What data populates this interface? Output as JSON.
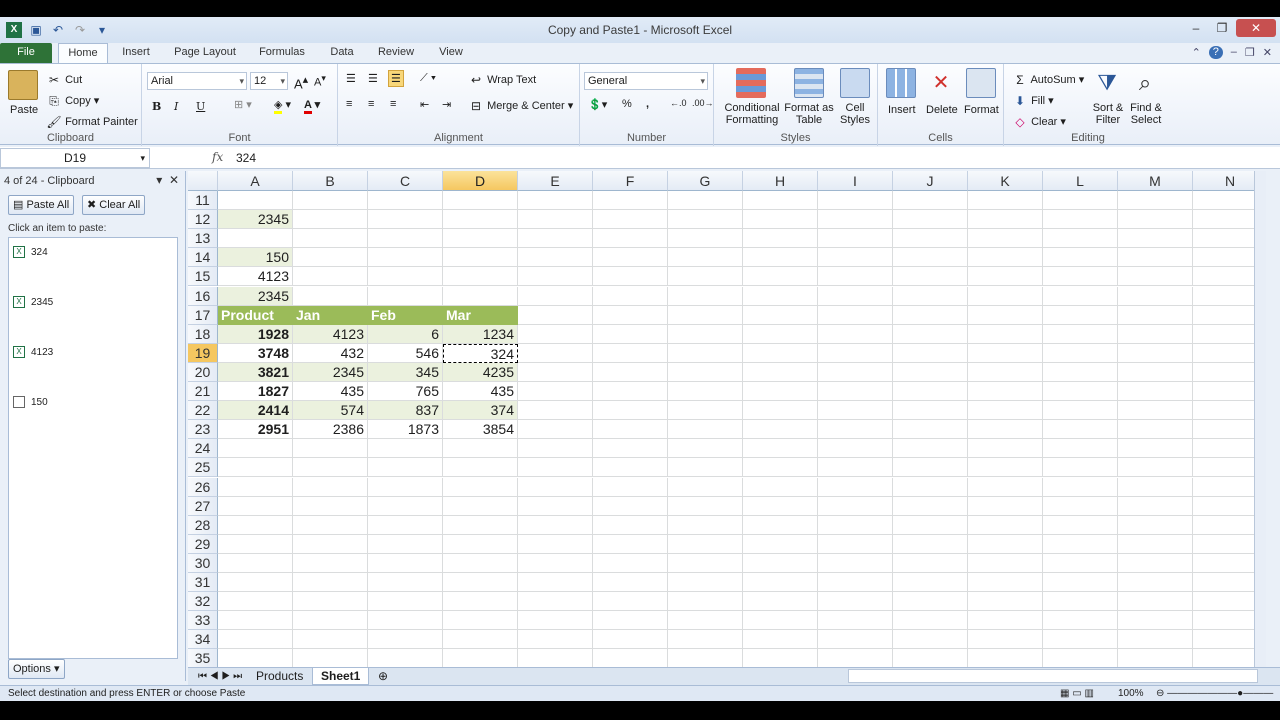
{
  "window": {
    "title": "Copy and Paste1  -  Microsoft Excel"
  },
  "tabs": [
    {
      "label": "File"
    },
    {
      "label": "Home"
    },
    {
      "label": "Insert"
    },
    {
      "label": "Page Layout"
    },
    {
      "label": "Formulas"
    },
    {
      "label": "Data"
    },
    {
      "label": "Review"
    },
    {
      "label": "View"
    }
  ],
  "ribbon": {
    "clipboard": {
      "paste": "Paste",
      "cut": "Cut",
      "copy": "Copy",
      "format_painter": "Format Painter",
      "group": "Clipboard"
    },
    "font": {
      "name": "Arial",
      "size": "12",
      "bold": "B",
      "italic": "I",
      "underline": "U",
      "group": "Font"
    },
    "alignment": {
      "wrap_text": "Wrap Text",
      "merge_center": "Merge & Center",
      "group": "Alignment"
    },
    "number": {
      "format": "General",
      "percent": "%",
      "comma": ",",
      "group": "Number"
    },
    "styles": {
      "conditional_formatting": "Conditional Formatting",
      "format_as_table": "Format as Table",
      "cell_styles": "Cell Styles",
      "group": "Styles"
    },
    "cells": {
      "insert": "Insert",
      "delete": "Delete",
      "format": "Format",
      "group": "Cells"
    },
    "editing": {
      "autosum": "AutoSum",
      "fill": "Fill",
      "clear": "Clear",
      "sort_filter": "Sort & Filter",
      "find_select": "Find & Select",
      "group": "Editing"
    }
  },
  "formula_bar": {
    "name_box": "D19",
    "fx": "fx",
    "value": "324"
  },
  "clipboard_pane": {
    "header": "4 of 24 - Clipboard",
    "paste_all": "Paste All",
    "clear_all": "Clear All",
    "hint": "Click an item to paste:",
    "items": [
      "324",
      "2345",
      "4123",
      "150"
    ],
    "options": "Options"
  },
  "grid": {
    "columns": [
      "A",
      "B",
      "C",
      "D",
      "E",
      "F",
      "G",
      "H",
      "I",
      "J",
      "K",
      "L",
      "M",
      "N"
    ],
    "selected_column": "D",
    "selected_row": "19",
    "rows": [
      "11",
      "12",
      "13",
      "14",
      "15",
      "16",
      "17",
      "18",
      "19",
      "20",
      "21",
      "22",
      "23",
      "24",
      "25",
      "26",
      "27",
      "28",
      "29",
      "30",
      "31",
      "32",
      "33",
      "34",
      "35"
    ],
    "cells": {
      "A12": "2345",
      "A14": "150",
      "A15": "4123",
      "A16": "2345",
      "A17": "Product",
      "B17": "Jan",
      "C17": "Feb",
      "D17": "Mar",
      "A18": "1928",
      "B18": "4123",
      "C18": "6",
      "D18": "1234",
      "A19": "3748",
      "B19": "432",
      "C19": "546",
      "D19": "324",
      "A20": "3821",
      "B20": "2345",
      "C20": "345",
      "D20": "4235",
      "A21": "1827",
      "B21": "435",
      "C21": "765",
      "D21": "435",
      "A22": "2414",
      "B22": "574",
      "C22": "837",
      "D22": "374",
      "A23": "2951",
      "B23": "2386",
      "C23": "1873",
      "D23": "3854"
    }
  },
  "sheet_tabs": [
    "Products",
    "Sheet1"
  ],
  "active_sheet": "Sheet1",
  "status": {
    "message": "Select destination and press ENTER or choose Paste",
    "zoom": "100%"
  },
  "colors": {
    "accent": "#2e7237",
    "table_header": "#9bbb59",
    "band": "#ebf1de",
    "selection": "#f5c760"
  }
}
